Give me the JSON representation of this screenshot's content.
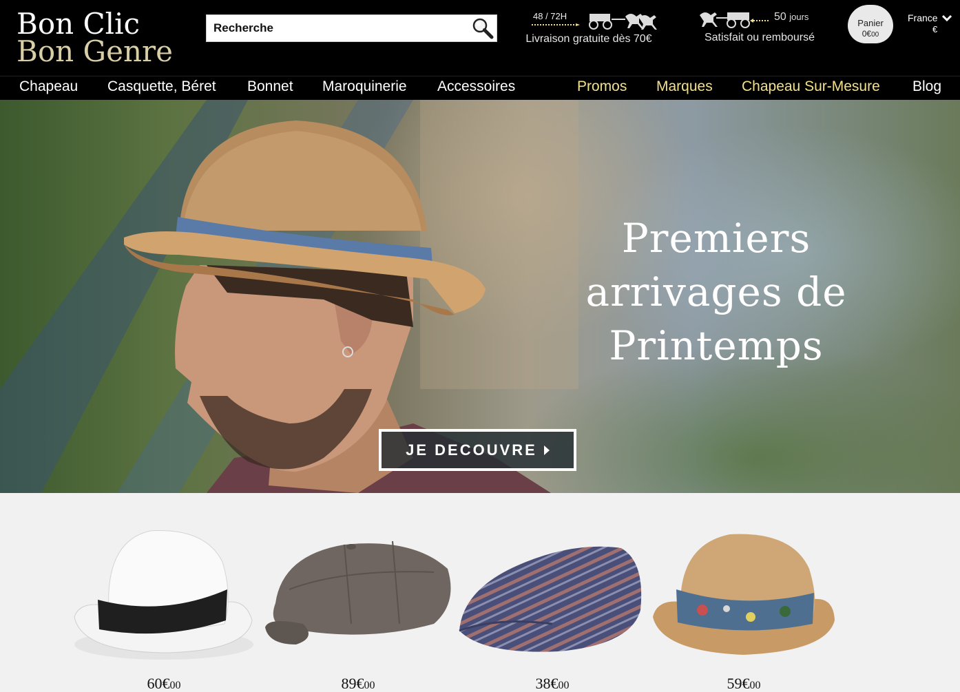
{
  "brand": {
    "logo_line1": "Bon Clic",
    "logo_line2": "Bon Genre"
  },
  "search": {
    "placeholder": "Recherche",
    "icon": "magnifier-icon"
  },
  "promos": {
    "delivery": {
      "top": "48 / 72H",
      "main": "Livraison gratuite dès 70€",
      "icon": "carriage-icon"
    },
    "refund": {
      "days_number": "50",
      "days_label": "jours",
      "main": "Satisfait ou remboursé",
      "icon": "carriage-icon"
    }
  },
  "cart": {
    "label": "Panier",
    "amount_main": "0€",
    "amount_cents": "00",
    "icon": "bag-icon"
  },
  "locale": {
    "country": "France",
    "currency": "€"
  },
  "nav": {
    "items": [
      "Chapeau",
      "Casquette, Béret",
      "Bonnet",
      "Maroquinerie",
      "Accessoires"
    ],
    "highlight": [
      "Promos",
      "Marques",
      "Chapeau Sur-Mesure",
      "Blog"
    ]
  },
  "hero": {
    "title_lines": [
      "Premiers",
      "arrivages de",
      "Printemps"
    ],
    "cta": "JE DECOUVRE"
  },
  "products": [
    {
      "price_main": "60€",
      "price_cents": "00",
      "image": "white-fedora"
    },
    {
      "price_main": "89€",
      "price_cents": "00",
      "image": "grey-newsboy-cap"
    },
    {
      "price_main": "38€",
      "price_cents": "00",
      "image": "striped-flat-cap"
    },
    {
      "price_main": "59€",
      "price_cents": "00",
      "image": "straw-trilby"
    }
  ],
  "colors": {
    "header_bg": "#000000",
    "nav_highlight": "#f2e08c",
    "logo_gold": "#d9cfa6",
    "page_bg": "#f1f1f1"
  }
}
